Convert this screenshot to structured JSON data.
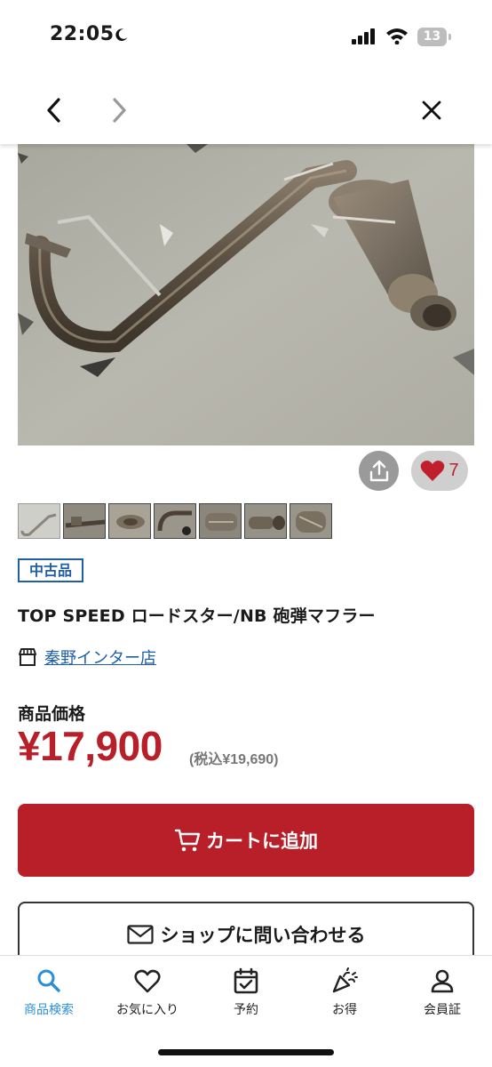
{
  "status_bar": {
    "time": "22:05",
    "battery": "13"
  },
  "nav": {
    "back_icon": "chevron-left-icon",
    "forward_icon": "chevron-right-icon",
    "close_icon": "close-icon"
  },
  "product": {
    "favorite_count": "7",
    "condition": "中古品",
    "title": "TOP SPEED ロードスター/NB 砲弾マフラー",
    "shop_name": "秦野インター店",
    "price_label": "商品価格",
    "price": "¥17,900",
    "price_tax": "(税込¥19,690)"
  },
  "actions": {
    "add_to_cart": "カートに追加",
    "contact_shop": "ショップに問い合わせる"
  },
  "tabs": [
    {
      "label": "商品検索",
      "icon": "search-icon",
      "active": true
    },
    {
      "label": "お気に入り",
      "icon": "heart-icon",
      "active": false
    },
    {
      "label": "予約",
      "icon": "calendar-check-icon",
      "active": false
    },
    {
      "label": "お得",
      "icon": "party-popper-icon",
      "active": false
    },
    {
      "label": "会員証",
      "icon": "user-icon",
      "active": false
    }
  ],
  "colors": {
    "accent_red": "#b81f28",
    "link_blue": "#1f5fa8",
    "tab_active": "#2b8fd6"
  }
}
